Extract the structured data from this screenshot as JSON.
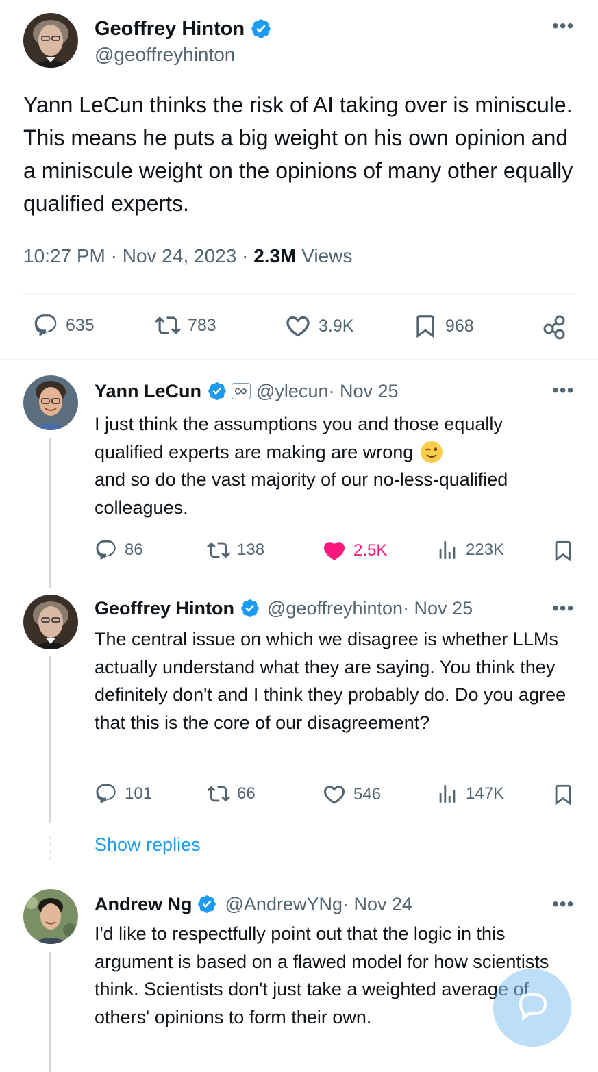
{
  "main_tweet": {
    "author_name": "Geoffrey Hinton",
    "author_handle": "@geoffreyhinton",
    "text": "Yann LeCun thinks the risk of AI taking over is miniscule. This means he puts a big weight on his own opinion and a miniscule weight on the opinions of many other equally qualified experts.",
    "time": "10:27 PM · Nov 24, 2023 · ",
    "views_count": "2.3M",
    "views_label": " Views",
    "replies": "635",
    "reposts": "783",
    "likes": "3.9K",
    "bookmarks": "968"
  },
  "replies": [
    {
      "author_name": "Yann LeCun",
      "author_handle": "@ylecun",
      "date": " · Nov 25",
      "text_line1": "I just think the assumptions you and those equally",
      "text_line2": "qualified experts are making are wrong",
      "emoji": "😉",
      "text_rest": "and so do the vast majority of our no-less-qualified colleagues.",
      "replies": "86",
      "reposts": "138",
      "likes": "2.5K",
      "views": "223K"
    },
    {
      "author_name": "Geoffrey Hinton",
      "author_handle": "@geoffreyhinton",
      "date": " · Nov 25",
      "text": "The central issue on which we disagree is whether LLMs actually understand what they are saying. You think they definitely don't and I think they probably do. Do you agree that this is the core of our disagreement?",
      "replies": "101",
      "reposts": "66",
      "likes": "546",
      "views": "147K",
      "show_replies": "Show replies"
    },
    {
      "author_name": "Andrew Ng",
      "author_handle": "@AndrewYNg",
      "date": " · Nov 24",
      "text": "I'd like to respectfully point out that the logic in this argument is based on a flawed model for how scientists think. Scientists don't just take a weighted average of others' opinions to form their own."
    }
  ],
  "icons": {
    "more": "more-dots-icon",
    "verified": "verified-badge-icon",
    "meta": "meta-affiliation-icon",
    "reply": "reply-bubble-icon",
    "repost": "repost-icon",
    "like": "heart-icon",
    "bookmark": "bookmark-icon",
    "share": "share-icon",
    "views": "views-bar-icon",
    "compose": "compose-fab-icon"
  },
  "colors": {
    "verified": "#1d9bf0",
    "liked": "#f91880",
    "link": "#1d9bf0",
    "muted": "#536471"
  }
}
